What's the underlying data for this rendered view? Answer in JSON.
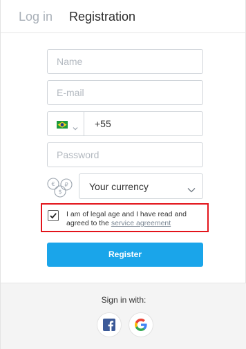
{
  "tabs": {
    "login": "Log in",
    "registration": "Registration"
  },
  "form": {
    "name_placeholder": "Name",
    "email_placeholder": "E-mail",
    "phone_code": "+55",
    "password_placeholder": "Password",
    "currency_label": "Your currency",
    "agree_text": "I am of legal age and I have read and agreed to the ",
    "agree_link": "service agreement",
    "agree_checked": true,
    "register_label": "Register"
  },
  "footer": {
    "signin_label": "Sign in with:"
  },
  "icons": {
    "flag": "brazil-flag-icon",
    "currency": "currency-coins-icon",
    "chevron": "chevron-down-icon",
    "check": "check-icon",
    "facebook": "facebook-icon",
    "google": "google-icon"
  },
  "colors": {
    "accent": "#1aa5ea",
    "highlight_border": "#e3141b"
  }
}
